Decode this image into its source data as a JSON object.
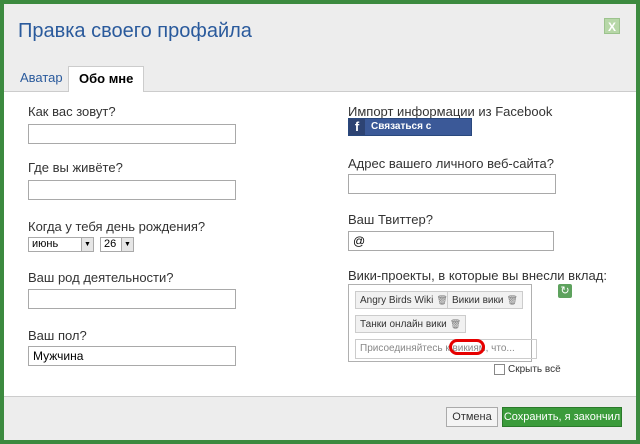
{
  "dialog": {
    "title": "Правка своего профайла",
    "close_label": "X"
  },
  "tabs": [
    {
      "label": "Аватар",
      "active": false
    },
    {
      "label": "Обо мне",
      "active": true
    }
  ],
  "left": {
    "name_label": "Как вас зовут?",
    "name_value": "",
    "location_label": "Где вы живёте?",
    "location_value": "",
    "birthday_label": "Когда у тебя день рождения?",
    "birthday_month": "июнь",
    "birthday_day": "26",
    "occupation_label": "Ваш род деятельности?",
    "occupation_value": "",
    "gender_label": "Ваш пол?",
    "gender_value": "Мужчина"
  },
  "right": {
    "facebook_label": "Импорт информации из Facebook",
    "facebook_button": "Связаться с Facebook",
    "website_label": "Адрес вашего личного веб-сайта?",
    "website_value": "",
    "twitter_label": "Ваш Твиттер?",
    "twitter_value": "@",
    "wikis_label": "Вики-проекты, в которые вы внесли вклад:",
    "wiki_tags": [
      "Angry Birds Wiki",
      "Викии вики",
      "Танки онлайн вики"
    ],
    "wiki_input_placeholder": "Присоединяйтесь к викиям, что...",
    "hide_all_label": "Скрыть всё"
  },
  "footer": {
    "cancel_label": "Отмена",
    "save_label": "Сохранить, я закончил"
  },
  "colors": {
    "frame": "#3c8a3f",
    "title": "#2a5a9c",
    "facebook": "#3b5998",
    "save_button": "#3b9b3b",
    "highlight_circle": "#e60000"
  },
  "icons": {
    "facebook": "facebook-icon",
    "trash": "trash-icon",
    "refresh": "refresh-icon",
    "close": "close-icon"
  }
}
